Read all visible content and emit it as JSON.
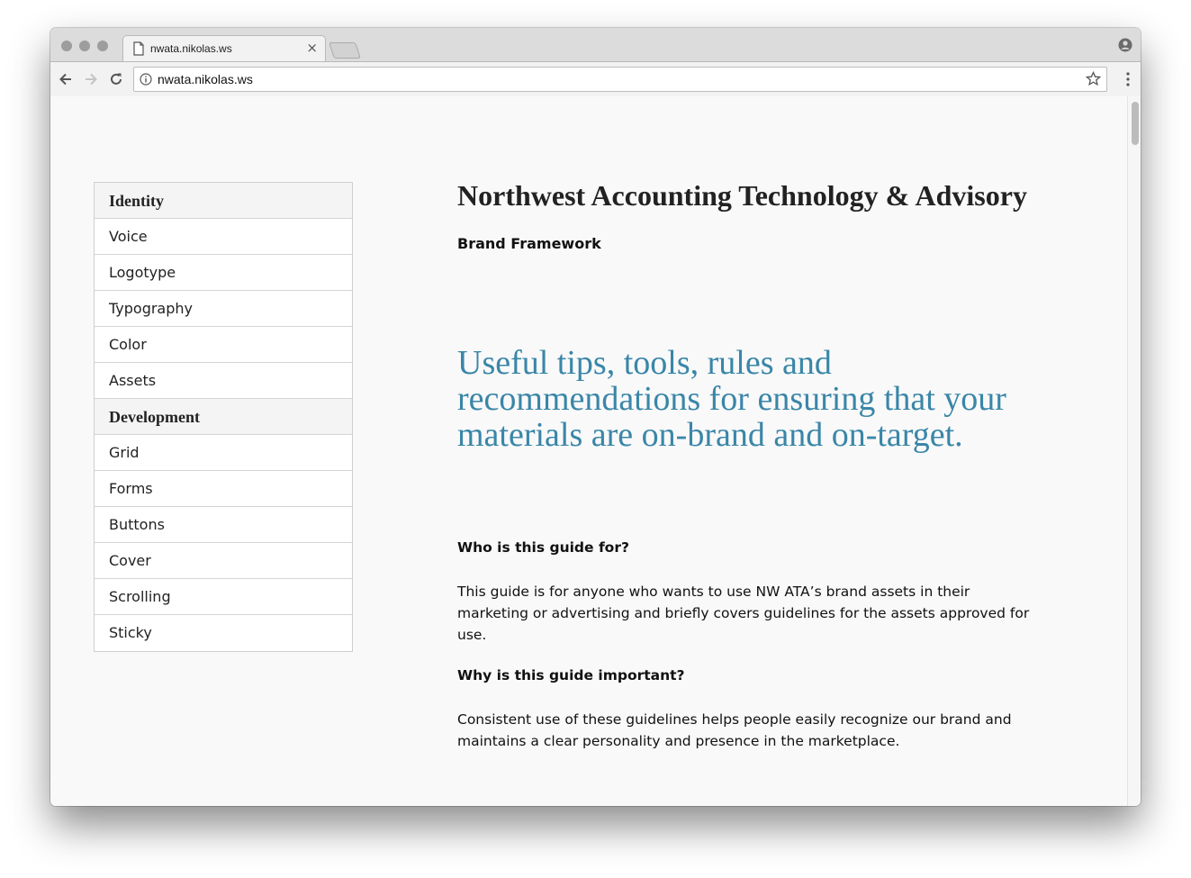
{
  "browser": {
    "tab_title": "nwata.nikolas.ws",
    "tab_close": "×",
    "url": "nwata.nikolas.ws",
    "icons": [
      "page-icon",
      "close-icon",
      "new-tab-icon",
      "profile-icon",
      "back-arrow-icon",
      "forward-arrow-icon",
      "reload-icon",
      "info-icon",
      "star-icon",
      "menu-icon"
    ]
  },
  "sidebar": {
    "items": [
      {
        "label": "Identity",
        "type": "heading"
      },
      {
        "label": "Voice",
        "type": "link"
      },
      {
        "label": "Logotype",
        "type": "link"
      },
      {
        "label": "Typography",
        "type": "link"
      },
      {
        "label": "Color",
        "type": "link"
      },
      {
        "label": "Assets",
        "type": "link"
      },
      {
        "label": "Development",
        "type": "heading"
      },
      {
        "label": "Grid",
        "type": "link"
      },
      {
        "label": "Forms",
        "type": "link"
      },
      {
        "label": "Buttons",
        "type": "link"
      },
      {
        "label": "Cover",
        "type": "link"
      },
      {
        "label": "Scrolling",
        "type": "link"
      },
      {
        "label": "Sticky",
        "type": "link"
      }
    ]
  },
  "main": {
    "title": "Northwest Accounting Technology & Advisory",
    "subtitle": "Brand Framework",
    "tagline": "Useful tips, tools, rules and recommendations for ensuring that your materials are on-brand and on-target.",
    "q1": "Who is this guide for?",
    "p1": "This guide is for anyone who wants to use NW ATA’s brand assets in their marketing or advertising and briefly covers guidelines for the assets approved for use.",
    "q2": "Why is this guide important?",
    "p2": "Consistent use of these guidelines helps people easily recognize our brand and maintains a clear personality and presence in the marketplace."
  },
  "colors": {
    "accent": "#3a86a8",
    "text": "#222222",
    "background": "#f9f9f9"
  }
}
